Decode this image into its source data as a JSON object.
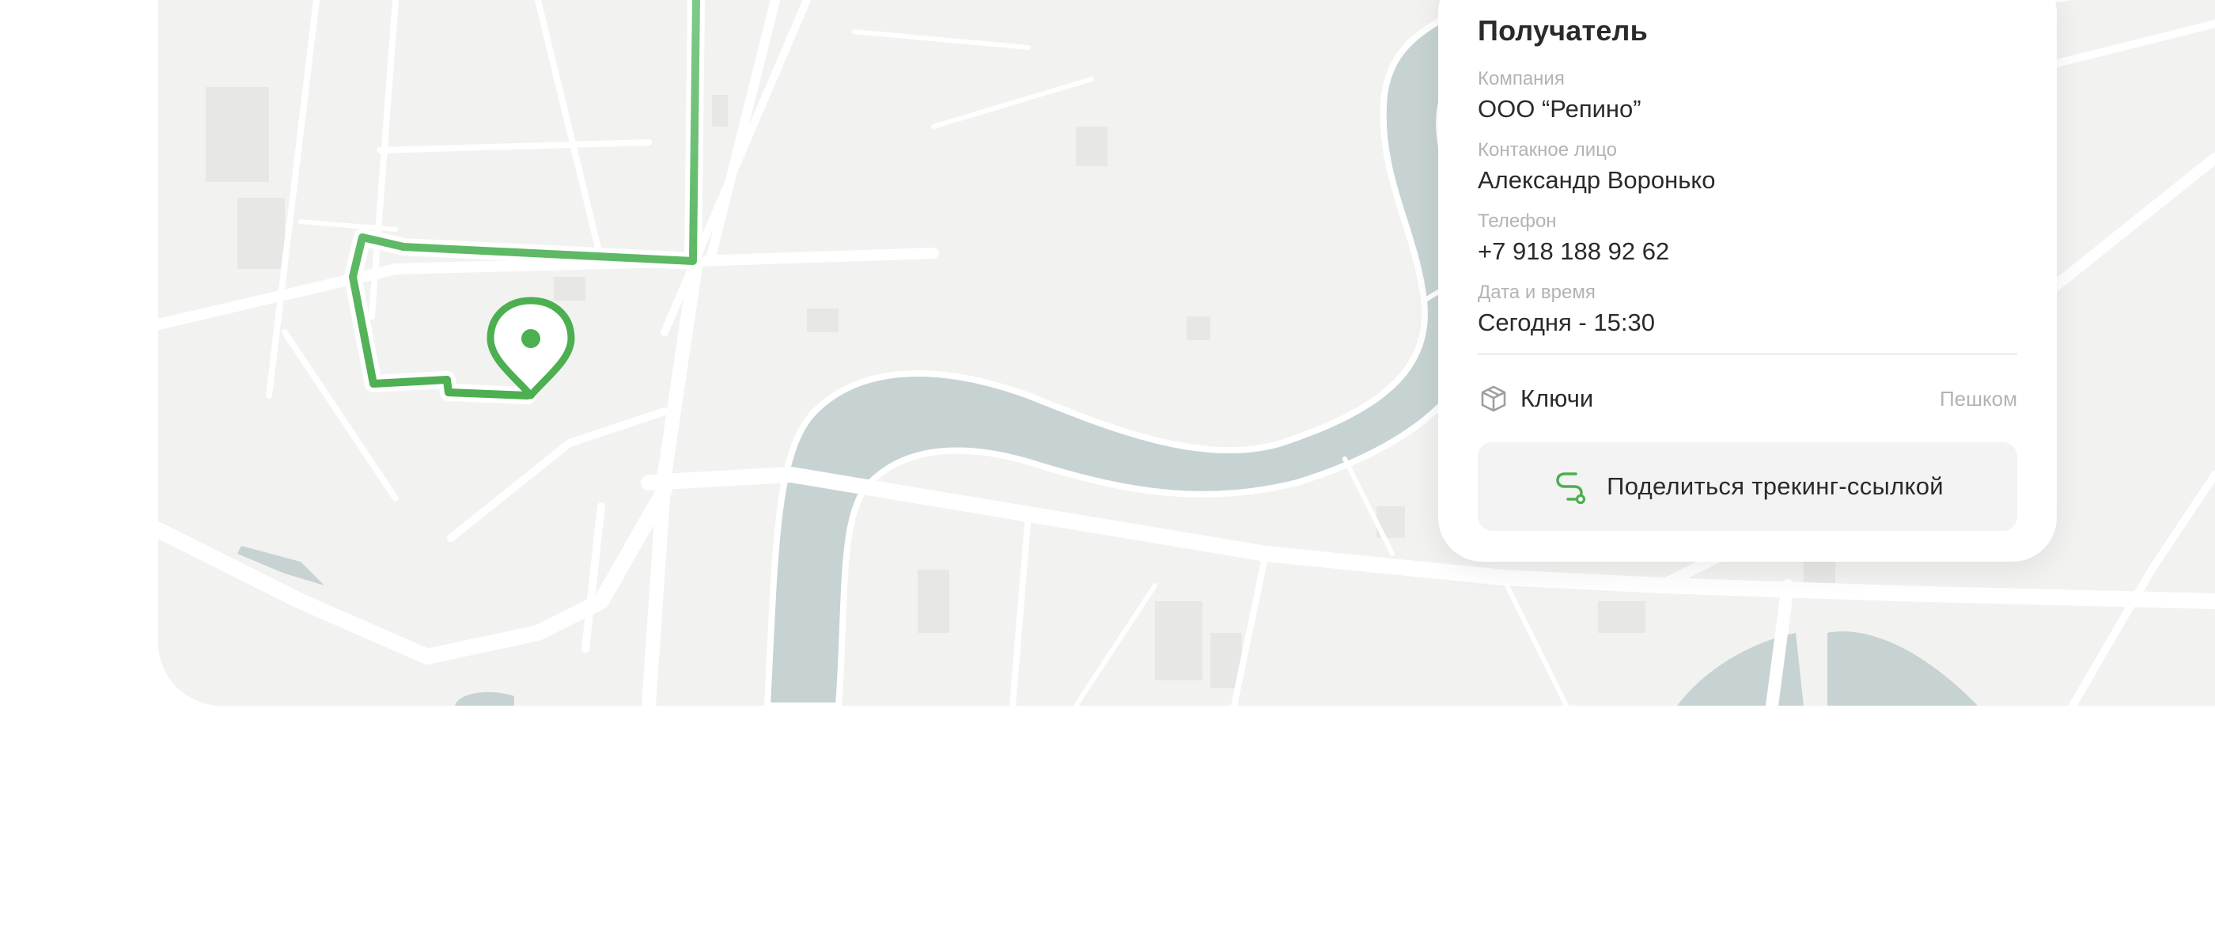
{
  "recipient": {
    "title": "Получатель",
    "company_label": "Компания",
    "company_value": "ООО “Репино”",
    "contact_label": "Контакное лицо",
    "contact_value": "Александр Воронько",
    "phone_label": "Телефон",
    "phone_value": "+7 918 188 92 62",
    "datetime_label": "Дата и время",
    "datetime_value": "Сегодня - 15:30"
  },
  "cargo": {
    "icon": "package-icon",
    "name": "Ключи",
    "mode": "Пешком"
  },
  "share_button": {
    "icon": "route-icon",
    "label": "Поделиться трекинг-ссылкой"
  },
  "colors": {
    "route": "#4caf50",
    "water": "#c7d3d2",
    "map_bg": "#f2f2f1",
    "road": "#ffffff"
  }
}
